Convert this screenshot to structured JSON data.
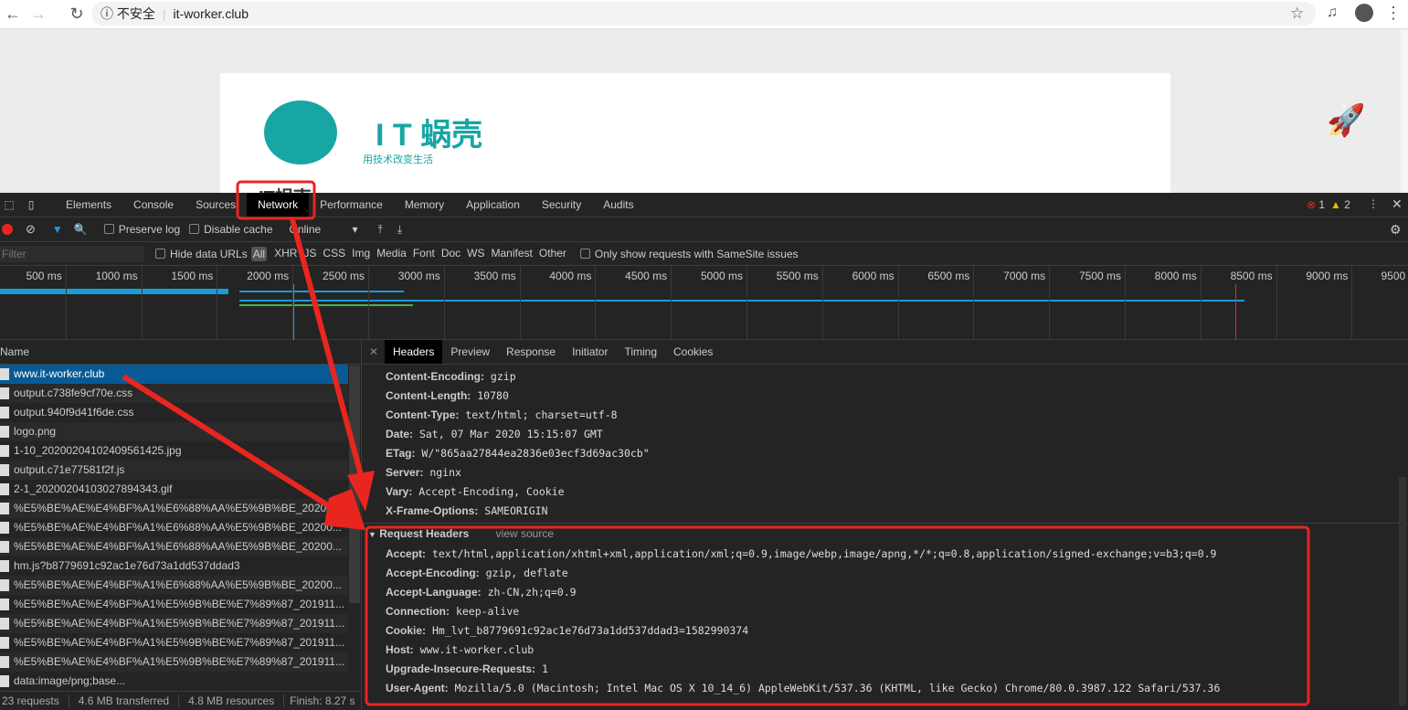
{
  "browser": {
    "security": "不安全",
    "url": "it-worker.club"
  },
  "page": {
    "logo_text": "I T 蜗壳",
    "slogan": "用技术改变生活",
    "heading_partial": "IT蜗壳"
  },
  "devtools": {
    "tabs": [
      "Elements",
      "Console",
      "Sources",
      "Network",
      "Performance",
      "Memory",
      "Application",
      "Security",
      "Audits"
    ],
    "active_tab": "Network",
    "errors": "1",
    "warnings": "2",
    "toolbar": {
      "preserve_log": "Preserve log",
      "disable_cache": "Disable cache",
      "throttle": "Online"
    },
    "filter": {
      "placeholder": "Filter",
      "hide_data_urls": "Hide data URLs",
      "types": [
        "All",
        "XHR",
        "JS",
        "CSS",
        "Img",
        "Media",
        "Font",
        "Doc",
        "WS",
        "Manifest",
        "Other"
      ],
      "samesite": "Only show requests with SameSite issues"
    },
    "timeline_ticks": [
      "500 ms",
      "1000 ms",
      "1500 ms",
      "2000 ms",
      "2500 ms",
      "3000 ms",
      "3500 ms",
      "4000 ms",
      "4500 ms",
      "5000 ms",
      "5500 ms",
      "6000 ms",
      "6500 ms",
      "7000 ms",
      "7500 ms",
      "8000 ms",
      "8500 ms",
      "9000 ms",
      "9500"
    ],
    "name_header": "Name",
    "requests": [
      "www.it-worker.club",
      "output.c738fe9cf70e.css",
      "output.940f9d41f6de.css",
      "logo.png",
      "1-10_20200204102409561425.jpg",
      "output.c71e77581f2f.js",
      "2-1_20200204103027894343.gif",
      "%E5%BE%AE%E4%BF%A1%E6%88%AA%E5%9B%BE_20200...",
      "%E5%BE%AE%E4%BF%A1%E6%88%AA%E5%9B%BE_20200...",
      "%E5%BE%AE%E4%BF%A1%E6%88%AA%E5%9B%BE_20200...",
      "hm.js?b8779691c92ac1e76d73a1dd537ddad3",
      "%E5%BE%AE%E4%BF%A1%E6%88%AA%E5%9B%BE_20200...",
      "%E5%BE%AE%E4%BF%A1%E5%9B%BE%E7%89%87_201911...",
      "%E5%BE%AE%E4%BF%A1%E5%9B%BE%E7%89%87_201911...",
      "%E5%BE%AE%E4%BF%A1%E5%9B%BE%E7%89%87_201911...",
      "%E5%BE%AE%E4%BF%A1%E5%9B%BE%E7%89%87_201911...",
      "data:image/png;base..."
    ],
    "status": {
      "requests": "23 requests",
      "transferred": "4.6 MB transferred",
      "resources": "4.8 MB resources",
      "finish": "Finish: 8.27 s"
    },
    "detail_tabs": [
      "Headers",
      "Preview",
      "Response",
      "Initiator",
      "Timing",
      "Cookies"
    ],
    "response_headers": [
      {
        "k": "Content-Encoding:",
        "v": "gzip"
      },
      {
        "k": "Content-Length:",
        "v": "10780"
      },
      {
        "k": "Content-Type:",
        "v": "text/html; charset=utf-8"
      },
      {
        "k": "Date:",
        "v": "Sat, 07 Mar 2020 15:15:07 GMT"
      },
      {
        "k": "ETag:",
        "v": "W/\"865aa27844ea2836e03ecf3d69ac30cb\""
      },
      {
        "k": "Server:",
        "v": "nginx"
      },
      {
        "k": "Vary:",
        "v": "Accept-Encoding, Cookie"
      },
      {
        "k": "X-Frame-Options:",
        "v": "SAMEORIGIN"
      }
    ],
    "request_headers_title": "Request Headers",
    "view_source": "view source",
    "request_headers": [
      {
        "k": "Accept:",
        "v": "text/html,application/xhtml+xml,application/xml;q=0.9,image/webp,image/apng,*/*;q=0.8,application/signed-exchange;v=b3;q=0.9"
      },
      {
        "k": "Accept-Encoding:",
        "v": "gzip, deflate"
      },
      {
        "k": "Accept-Language:",
        "v": "zh-CN,zh;q=0.9"
      },
      {
        "k": "Connection:",
        "v": "keep-alive"
      },
      {
        "k": "Cookie:",
        "v": "Hm_lvt_b8779691c92ac1e76d73a1dd537ddad3=1582990374"
      },
      {
        "k": "Host:",
        "v": "www.it-worker.club"
      },
      {
        "k": "Upgrade-Insecure-Requests:",
        "v": "1"
      },
      {
        "k": "User-Agent:",
        "v": "Mozilla/5.0 (Macintosh; Intel Mac OS X 10_14_6) AppleWebKit/537.36 (KHTML, like Gecko) Chrome/80.0.3987.122 Safari/537.36"
      }
    ]
  },
  "colors": {
    "annotation": "#e8261f",
    "selected": "#075a96",
    "accent": "#1a9cd8"
  }
}
